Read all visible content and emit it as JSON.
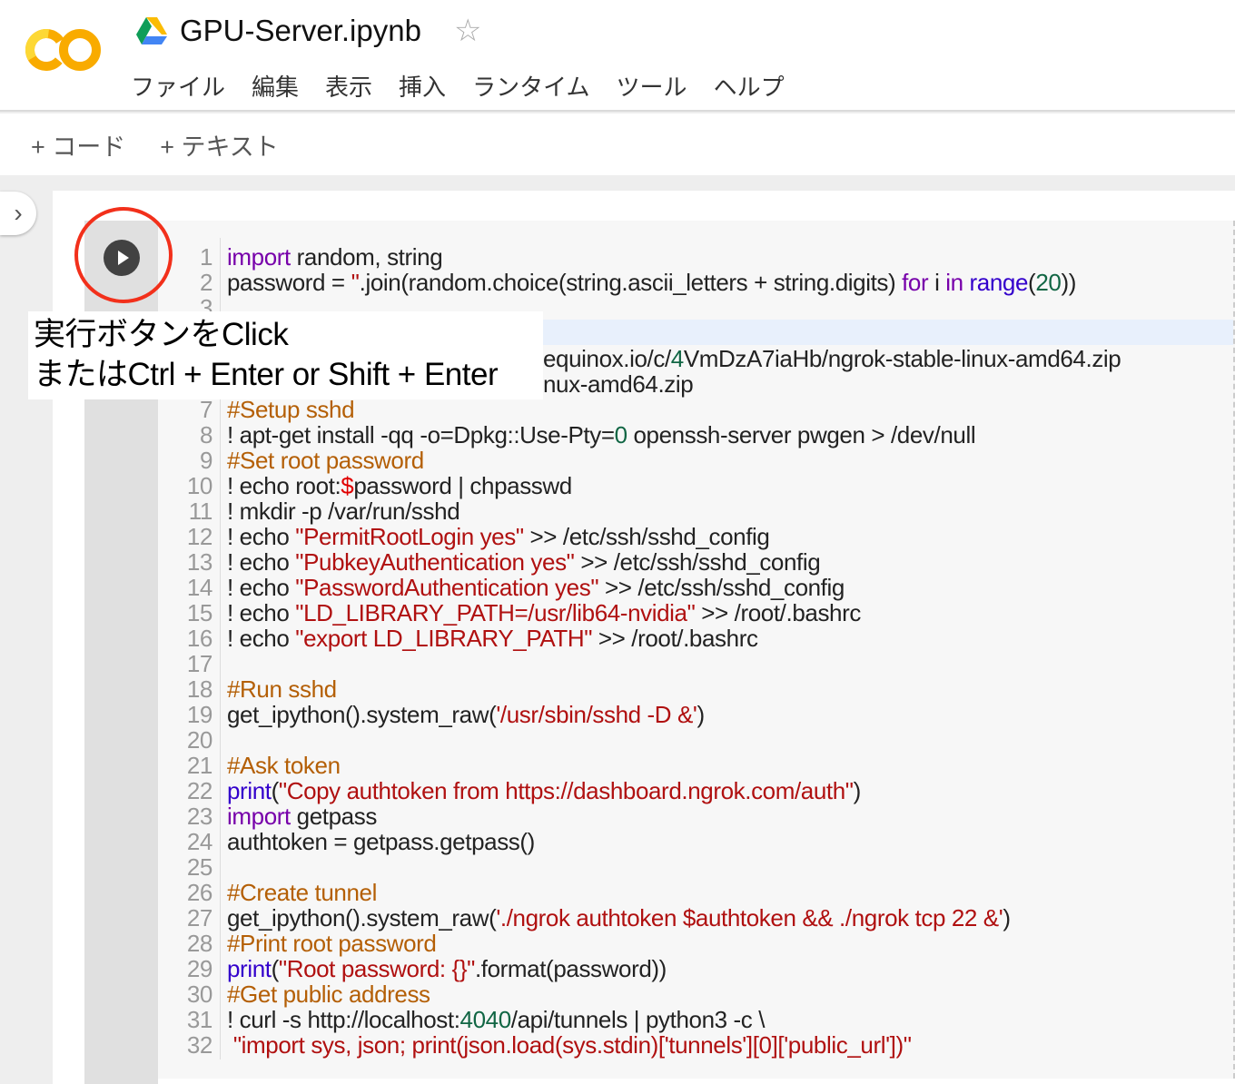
{
  "header": {
    "title": "GPU-Server.ipynb",
    "logo": "colab-logo",
    "menu": [
      "ファイル",
      "編集",
      "表示",
      "挿入",
      "ランタイム",
      "ツール",
      "ヘルプ"
    ]
  },
  "toolbar": {
    "add_code": "+ コード",
    "add_text": "+ テキスト"
  },
  "tooltip": {
    "line1": "実行ボタンをClick",
    "line2": "またはCtrl + Enter or Shift + Enter"
  },
  "colors": {
    "run_highlight": "#f2301b",
    "keyword": "#7700aa",
    "builtin": "#3300cc",
    "string": "#b01010",
    "comment": "#b45f06",
    "number": "#116644"
  },
  "code": [
    [
      [
        "k",
        "import"
      ],
      [
        "p",
        " random, string"
      ]
    ],
    [
      [
        "p",
        "password = "
      ],
      [
        "s",
        "''"
      ],
      [
        "p",
        ".join(random.choice(string.ascii_letters + string.digits) "
      ],
      [
        "k",
        "for"
      ],
      [
        "p",
        " i "
      ],
      [
        "k",
        "in"
      ],
      [
        "p",
        " "
      ],
      [
        "b",
        "range"
      ],
      [
        "p",
        "("
      ],
      [
        "n",
        "20"
      ],
      [
        "p",
        "))"
      ]
    ],
    [],
    [],
    [
      [
        "p",
        "equinox.io/c/"
      ],
      [
        "n",
        "4"
      ],
      [
        "p",
        "VmDzA7iaHb/ngrok-stable-linux-amd64.zip"
      ]
    ],
    [
      [
        "p",
        "nux-amd64.zip"
      ]
    ],
    [
      [
        "c",
        "#Setup sshd"
      ]
    ],
    [
      [
        "p",
        "! apt-get install -qq -o=Dpkg::Use-Pty="
      ],
      [
        "n",
        "0"
      ],
      [
        "p",
        " openssh-server pwgen > /dev/null"
      ]
    ],
    [
      [
        "c",
        "#Set root password"
      ]
    ],
    [
      [
        "p",
        "! echo root:"
      ],
      [
        "v",
        "$"
      ],
      [
        "p",
        "password | chpasswd"
      ]
    ],
    [
      [
        "p",
        "! mkdir -p /var/run/sshd"
      ]
    ],
    [
      [
        "p",
        "! echo "
      ],
      [
        "s",
        "\"PermitRootLogin yes\""
      ],
      [
        "p",
        " >> /etc/ssh/sshd_config"
      ]
    ],
    [
      [
        "p",
        "! echo "
      ],
      [
        "s",
        "\"PubkeyAuthentication yes\""
      ],
      [
        "p",
        " >> /etc/ssh/sshd_config"
      ]
    ],
    [
      [
        "p",
        "! echo "
      ],
      [
        "s",
        "\"PasswordAuthentication yes\""
      ],
      [
        "p",
        " >> /etc/ssh/sshd_config"
      ]
    ],
    [
      [
        "p",
        "! echo "
      ],
      [
        "s",
        "\"LD_LIBRARY_PATH=/usr/lib64-nvidia\""
      ],
      [
        "p",
        " >> /root/.bashrc"
      ]
    ],
    [
      [
        "p",
        "! echo "
      ],
      [
        "s",
        "\"export LD_LIBRARY_PATH\""
      ],
      [
        "p",
        " >> /root/.bashrc"
      ]
    ],
    [],
    [
      [
        "c",
        "#Run sshd"
      ]
    ],
    [
      [
        "p",
        "get_ipython().system_raw("
      ],
      [
        "s",
        "'/usr/sbin/sshd -D &'"
      ],
      [
        "p",
        ")"
      ]
    ],
    [],
    [
      [
        "c",
        "#Ask token"
      ]
    ],
    [
      [
        "b",
        "print"
      ],
      [
        "p",
        "("
      ],
      [
        "s",
        "\"Copy authtoken from https://dashboard.ngrok.com/auth\""
      ],
      [
        "p",
        ")"
      ]
    ],
    [
      [
        "k",
        "import"
      ],
      [
        "p",
        " getpass"
      ]
    ],
    [
      [
        "p",
        "authtoken = getpass.getpass()"
      ]
    ],
    [],
    [
      [
        "c",
        "#Create tunnel"
      ]
    ],
    [
      [
        "p",
        "get_ipython().system_raw("
      ],
      [
        "s",
        "'./ngrok authtoken $authtoken && ./ngrok tcp 22 &'"
      ],
      [
        "p",
        ")"
      ]
    ],
    [
      [
        "c",
        "#Print root password"
      ]
    ],
    [
      [
        "b",
        "print"
      ],
      [
        "p",
        "("
      ],
      [
        "s",
        "\"Root password: {}\""
      ],
      [
        "p",
        ".format(password))"
      ]
    ],
    [
      [
        "c",
        "#Get public address"
      ]
    ],
    [
      [
        "p",
        "! curl -s http://localhost:"
      ],
      [
        "n",
        "4040"
      ],
      [
        "p",
        "/api/tunnels | python3 -c \\"
      ]
    ],
    [
      [
        "p",
        "    "
      ],
      [
        "s",
        "\"import sys, json; print(json.load(sys.stdin)['tunnels'][0]['public_url'])\""
      ]
    ]
  ]
}
